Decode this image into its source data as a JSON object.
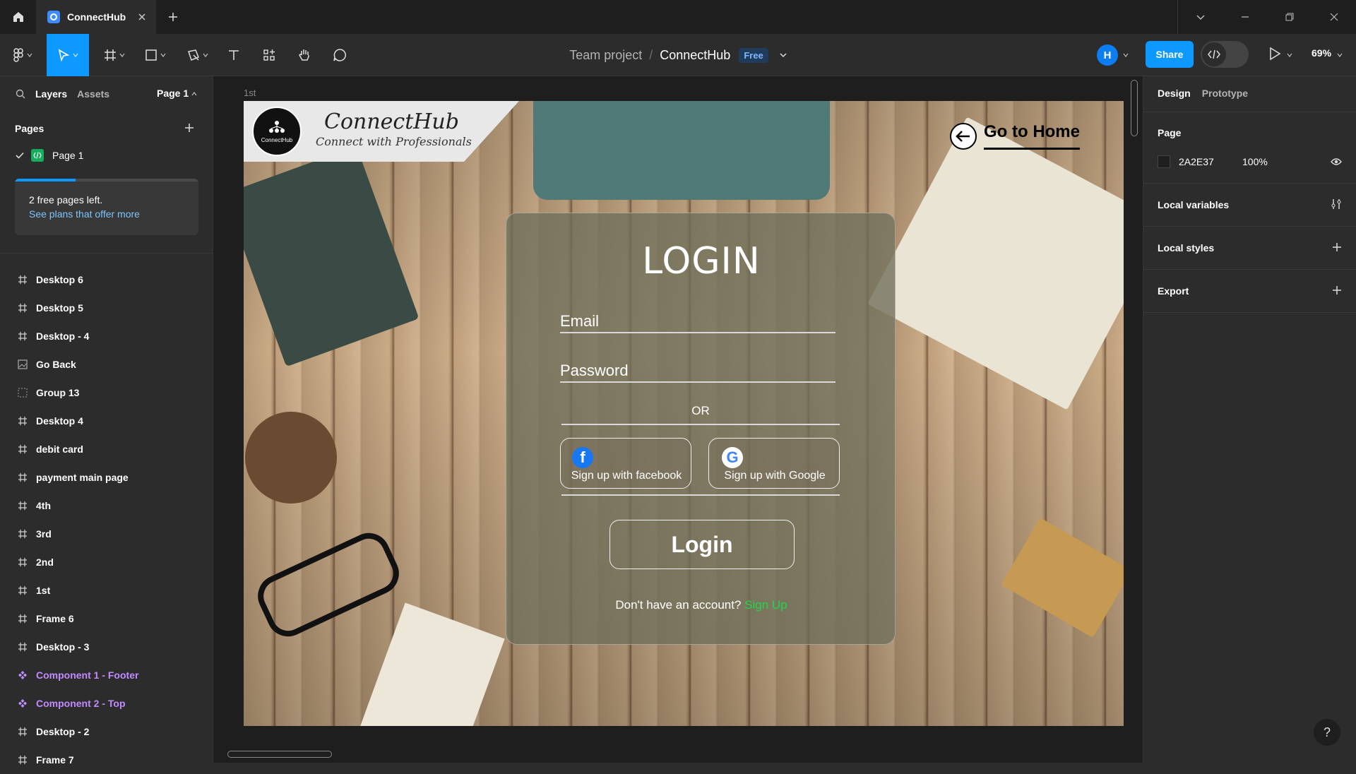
{
  "titlebar": {
    "tab_title": "ConnectHub"
  },
  "toolbar": {
    "breadcrumb_team": "Team project",
    "breadcrumb_sep": "/",
    "breadcrumb_file": "ConnectHub",
    "plan_badge": "Free",
    "avatar_initial": "H",
    "share_label": "Share",
    "zoom": "69%"
  },
  "left_panel": {
    "tabs": [
      "Layers",
      "Assets"
    ],
    "page_selector": "Page 1",
    "pages_header": "Pages",
    "current_page": "Page 1",
    "free_pages_text": "2 free pages left.",
    "see_plans_link": "See plans that offer more",
    "progress_fraction": 0.33,
    "layers": [
      {
        "label": "Desktop 6",
        "icon": "frame-icon"
      },
      {
        "label": "Desktop 5",
        "icon": "frame-icon"
      },
      {
        "label": "Desktop - 4",
        "icon": "frame-icon"
      },
      {
        "label": "Go Back",
        "icon": "image-icon"
      },
      {
        "label": "Group 13",
        "icon": "group-icon"
      },
      {
        "label": "Desktop 4",
        "icon": "frame-icon"
      },
      {
        "label": "debit card",
        "icon": "frame-icon"
      },
      {
        "label": "payment main page",
        "icon": "frame-icon"
      },
      {
        "label": "4th",
        "icon": "frame-icon"
      },
      {
        "label": "3rd",
        "icon": "frame-icon"
      },
      {
        "label": "2nd",
        "icon": "frame-icon"
      },
      {
        "label": "1st",
        "icon": "frame-icon"
      },
      {
        "label": "Frame 6",
        "icon": "frame-icon"
      },
      {
        "label": "Desktop - 3",
        "icon": "frame-icon"
      },
      {
        "label": "Component 1 - Footer",
        "icon": "component-icon"
      },
      {
        "label": "Component 2 - Top",
        "icon": "component-icon"
      },
      {
        "label": "Desktop - 2",
        "icon": "frame-icon"
      },
      {
        "label": "Frame 7",
        "icon": "frame-icon"
      }
    ]
  },
  "canvas": {
    "frame_label": "1st",
    "logo_name": "ConnectHub",
    "logo_small_text": "ConnectHub",
    "logo_tagline": "Connect with Professionals",
    "go_home": "Go to Home",
    "login_title": "LOGIN",
    "email_placeholder": "Email",
    "password_placeholder": "Password",
    "or_text": "OR",
    "facebook_label": "Sign up with  facebook",
    "google_label": "Sign up with Google",
    "login_button": "Login",
    "no_account_text": "Don't have an account?",
    "signup_link": "Sign Up"
  },
  "right_panel": {
    "tabs": [
      "Design",
      "Prototype"
    ],
    "page_section": "Page",
    "page_color_hex": "2A2E37",
    "page_opacity": "100%",
    "local_variables": "Local variables",
    "local_styles": "Local styles",
    "export": "Export"
  },
  "help_label": "?",
  "colors": {
    "accent": "#0d99ff",
    "component": "#c38bff",
    "signup_green": "#1ed84a"
  }
}
